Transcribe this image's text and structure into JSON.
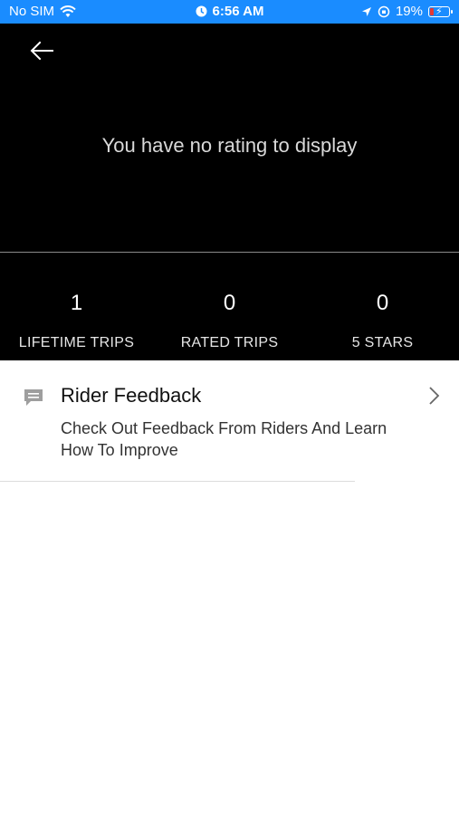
{
  "status_bar": {
    "carrier": "No SIM",
    "time": "6:56 AM",
    "battery": "19%",
    "battery_level": 0.19,
    "bar_color": "#1a8cff",
    "icons": [
      "wifi-icon",
      "alarm-icon",
      "location-icon",
      "orientation-lock-icon",
      "battery-icon"
    ]
  },
  "header": {
    "back_icon": "arrow-left-icon",
    "message": "You have no rating to display"
  },
  "stats": [
    {
      "value": "1",
      "label": "LIFETIME TRIPS"
    },
    {
      "value": "0",
      "label": "RATED TRIPS"
    },
    {
      "value": "0",
      "label": "5 STARS"
    }
  ],
  "feedback": {
    "icon": "chat-bubble-icon",
    "title": "Rider Feedback",
    "subtitle": "Check Out Feedback From Riders And Learn How To Improve",
    "chevron_icon": "chevron-right-icon"
  }
}
